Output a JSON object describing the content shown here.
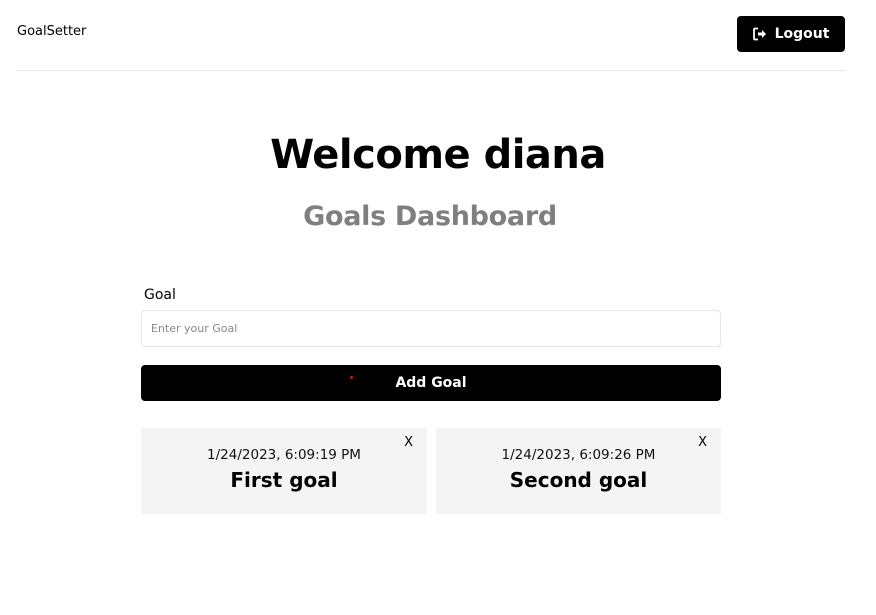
{
  "header": {
    "brand": "GoalSetter",
    "logout_label": "Logout"
  },
  "main": {
    "welcome": "Welcome diana",
    "subtitle": "Goals Dashboard"
  },
  "form": {
    "goal_label": "Goal",
    "goal_placeholder": "Enter your Goal",
    "goal_value": "",
    "add_button_label": "Add Goal"
  },
  "goals": [
    {
      "date": "1/24/2023, 6:09:19 PM",
      "text": "First goal",
      "delete_label": "X"
    },
    {
      "date": "1/24/2023, 6:09:26 PM",
      "text": "Second goal",
      "delete_label": "X"
    }
  ],
  "colors": {
    "primary": "#000000",
    "subtitle": "#7f7f7f",
    "card_bg": "#f4f4f4",
    "accent_dot": "#e01010"
  },
  "icons": {
    "logout": "sign-out-icon",
    "delete": "close-icon"
  }
}
